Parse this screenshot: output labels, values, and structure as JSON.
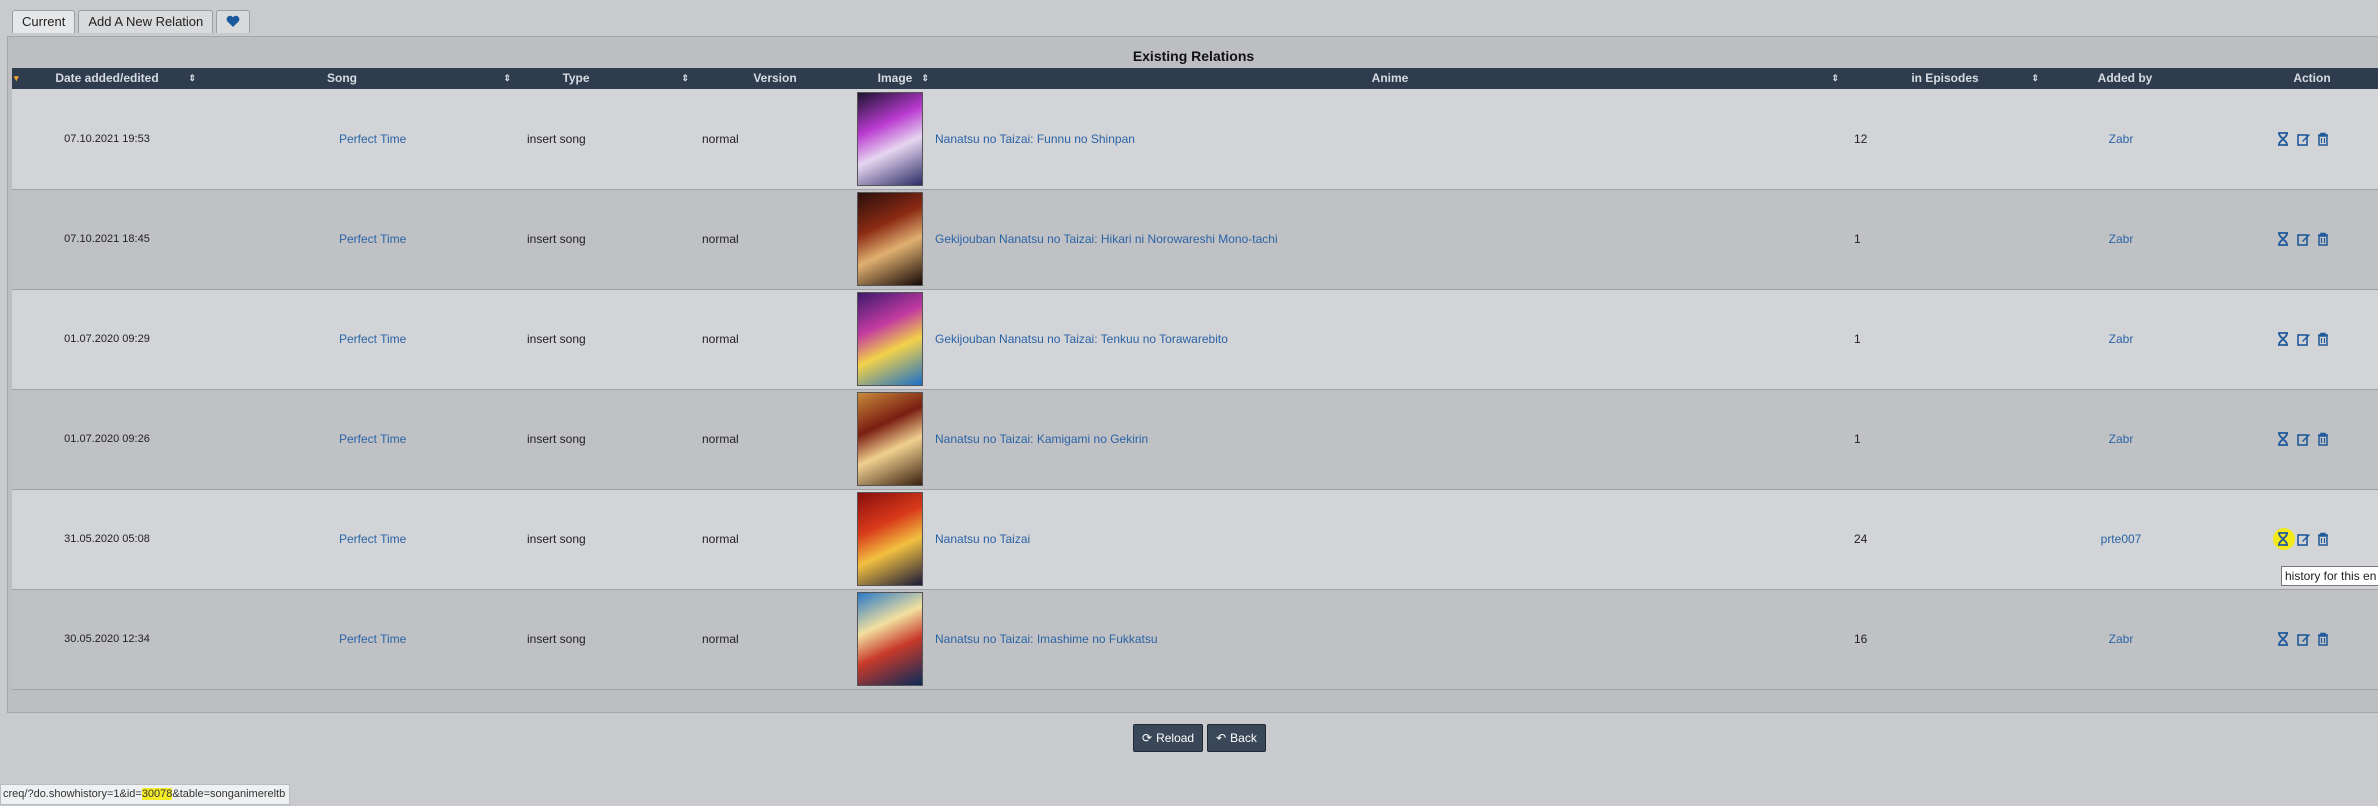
{
  "tabs": [
    {
      "label": "Current"
    },
    {
      "label": "Add A New Relation"
    }
  ],
  "favorite_icon": "heart-icon",
  "panel": {
    "title": "Existing Relations"
  },
  "columns": {
    "date": "Date added/edited",
    "song": "Song",
    "type": "Type",
    "version": "Version",
    "image": "Image",
    "anime": "Anime",
    "episodes": "in Episodes",
    "added_by": "Added by",
    "action": "Action"
  },
  "rows": [
    {
      "date": "07.10.2021 19:53",
      "song": "Perfect Time",
      "type": "insert song",
      "version": "normal",
      "anime": "Nanatsu no Taizai: Funnu no Shinpan",
      "episodes": "12",
      "added_by": "Zabr",
      "poster": [
        "#1c1430",
        "#b93ad0",
        "#e6d6f0",
        "#2b2b66"
      ]
    },
    {
      "date": "07.10.2021 18:45",
      "song": "Perfect Time",
      "type": "insert song",
      "version": "normal",
      "anime": "Gekijouban Nanatsu no Taizai: Hikari ni Norowareshi Mono-tachi",
      "episodes": "1",
      "added_by": "Zabr",
      "poster": [
        "#2a0f0a",
        "#8b2a14",
        "#e0b070",
        "#140806"
      ]
    },
    {
      "date": "01.07.2020 09:29",
      "song": "Perfect Time",
      "type": "insert song",
      "version": "normal",
      "anime": "Gekijouban Nanatsu no Taizai: Tenkuu no Torawarebito",
      "episodes": "1",
      "added_by": "Zabr",
      "poster": [
        "#3d1a6e",
        "#c23aa0",
        "#f2d24a",
        "#1a6ec8"
      ]
    },
    {
      "date": "01.07.2020 09:26",
      "song": "Perfect Time",
      "type": "insert song",
      "version": "normal",
      "anime": "Nanatsu no Taizai: Kamigami no Gekirin",
      "episodes": "1",
      "added_by": "Zabr",
      "poster": [
        "#c88a3a",
        "#7a1e12",
        "#f0d090",
        "#3a2010"
      ]
    },
    {
      "date": "31.05.2020 05:08",
      "song": "Perfect Time",
      "type": "insert song",
      "version": "normal",
      "anime": "Nanatsu no Taizai",
      "episodes": "24",
      "added_by": "prte007",
      "poster": [
        "#8a0e0e",
        "#d83a1a",
        "#f2c040",
        "#1a1a3a"
      ]
    },
    {
      "date": "30.05.2020 12:34",
      "song": "Perfect Time",
      "type": "insert song",
      "version": "normal",
      "anime": "Nanatsu no Taizai: Imashime no Fukkatsu",
      "episodes": "16",
      "added_by": "Zabr",
      "poster": [
        "#2a7ac8",
        "#f2e0a0",
        "#c83a2a",
        "#0a2a5a"
      ]
    }
  ],
  "tooltip": "history for this en",
  "buttons": {
    "reload": "Reload",
    "back": "Back"
  },
  "status": {
    "prefix": "creq/?do.showhistory=1&id=",
    "id": "30078",
    "suffix": "&table=songanimereltb"
  },
  "colors": {
    "header_bg": "#2f3c4e",
    "link": "#2a64a6",
    "accent": "#f0a830",
    "icon": "#1f5a9a",
    "highlight": "#f2e81a"
  }
}
